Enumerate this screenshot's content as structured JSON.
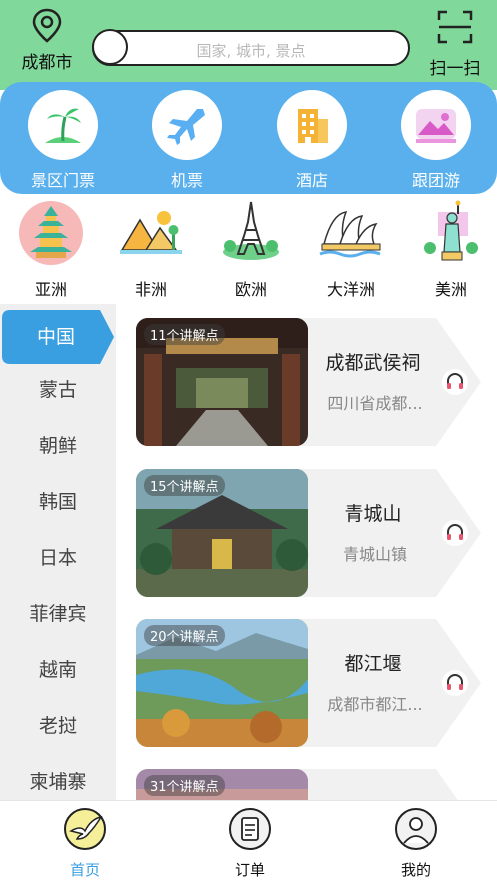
{
  "header": {
    "location_label": "成都市",
    "search_placeholder": "国家, 城市, 景点",
    "scan_label": "扫一扫"
  },
  "categories": [
    {
      "label": "景区门票",
      "icon": "palm-tree-icon"
    },
    {
      "label": "机票",
      "icon": "airplane-icon"
    },
    {
      "label": "酒店",
      "icon": "hotel-icon"
    },
    {
      "label": "跟团游",
      "icon": "group-tour-icon"
    }
  ],
  "continents": [
    {
      "label": "亚洲",
      "icon": "pagoda-icon"
    },
    {
      "label": "非洲",
      "icon": "pyramids-icon"
    },
    {
      "label": "欧洲",
      "icon": "eiffel-tower-icon"
    },
    {
      "label": "大洋洲",
      "icon": "opera-house-icon"
    },
    {
      "label": "美洲",
      "icon": "statue-of-liberty-icon"
    }
  ],
  "countries": {
    "active": "中国",
    "items": [
      "蒙古",
      "朝鲜",
      "韩国",
      "日本",
      "菲律宾",
      "越南",
      "老挝",
      "柬埔寨"
    ]
  },
  "cards": [
    {
      "badge": "11个讲解点",
      "title": "成都武侯祠",
      "subtitle": "四川省成都..."
    },
    {
      "badge": "15个讲解点",
      "title": "青城山",
      "subtitle": "青城山镇"
    },
    {
      "badge": "20个讲解点",
      "title": "都江堰",
      "subtitle": "成都市都江..."
    },
    {
      "badge": "31个讲解点",
      "title": "",
      "subtitle": ""
    }
  ],
  "tabs": [
    {
      "label": "首页",
      "active": true
    },
    {
      "label": "订单",
      "active": false
    },
    {
      "label": "我的",
      "active": false
    }
  ],
  "colors": {
    "header_green": "#80d99a",
    "panel_blue": "#5ab0ec",
    "active_tab_blue": "#3a9fe0"
  }
}
